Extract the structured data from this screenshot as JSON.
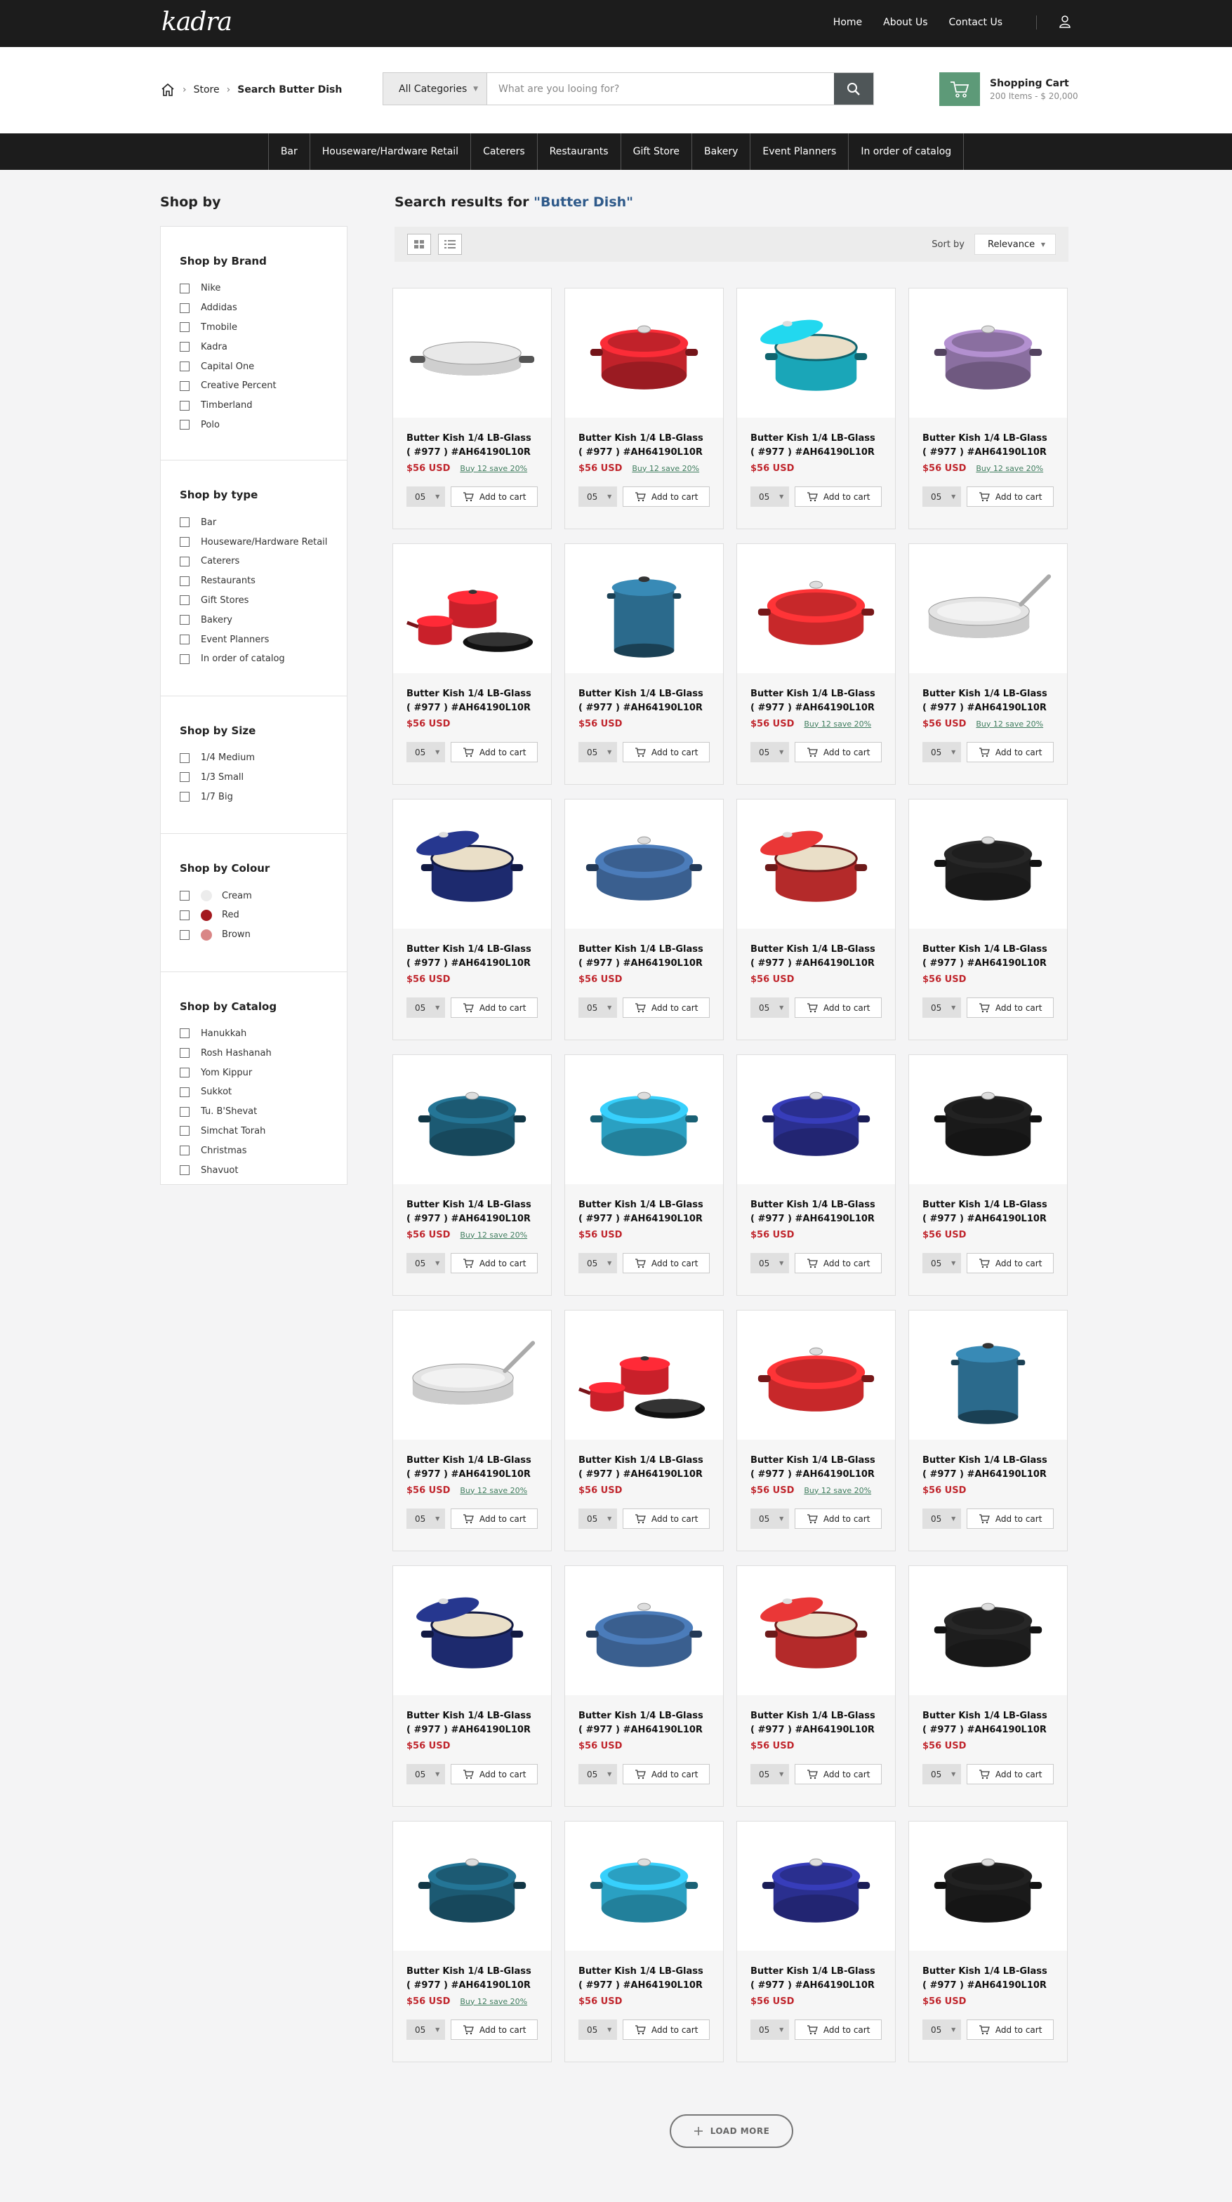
{
  "brand": {
    "logo": "kadra"
  },
  "topnav": [
    "Home",
    "About Us",
    "Contact Us"
  ],
  "breadcrumb": {
    "store": "Store",
    "current": "Search Butter Dish"
  },
  "search": {
    "category": "All Categories",
    "placeholder": "What are you looing for?"
  },
  "cart": {
    "title": "Shopping Cart",
    "summary": "200 Items - $ 20,000",
    "accent": "#5d9a78"
  },
  "categories": [
    "Bar",
    "Houseware/Hardware Retail",
    "Caterers",
    "Restaurants",
    "Gift Store",
    "Bakery",
    "Event Planners",
    "In order of catalog"
  ],
  "sidebar": {
    "title": "Shop by",
    "sections": [
      {
        "title": "Shop by Brand",
        "items": [
          "Nike",
          "Addidas",
          "Tmobile",
          "Kadra",
          "Capital One",
          "Creative Percent",
          "Timberland",
          "Polo"
        ]
      },
      {
        "title": "Shop by type",
        "items": [
          "Bar",
          "Houseware/Hardware Retail",
          "Caterers",
          "Restaurants",
          "Gift Stores",
          "Bakery",
          "Event Planners",
          "In order of catalog"
        ]
      },
      {
        "title": "Shop by Size",
        "items": [
          "1/4 Medium",
          "1/3 Small",
          "1/7 Big"
        ]
      },
      {
        "title": "Shop by Colour",
        "items": [
          "Cream",
          "Red",
          "Brown"
        ],
        "colors": [
          "#ececec",
          "#a3181e",
          "#d98686"
        ]
      },
      {
        "title": "Shop by Catalog",
        "items": [
          "Hanukkah",
          "Rosh Hashanah",
          "Yom Kippur",
          "Sukkot",
          "Tu. B'Shevat",
          "Simchat Torah",
          "Christmas",
          "Shavuot"
        ]
      }
    ]
  },
  "results": {
    "prefix": "Search results for ",
    "query": "\"Butter Dish\""
  },
  "sort": {
    "label": "Sort by",
    "value": "Relevance"
  },
  "product_template": {
    "name_line1": "Butter Kish 1/4 LB-Glass",
    "name_line2": "( #977 ) #AH64190L10R",
    "price": "$56 USD",
    "promo": "Buy 12 save 20%",
    "qty": "05",
    "add_label": "Add to cart"
  },
  "products": [
    {
      "kind": "pan",
      "color": "#b8b8b8",
      "promo": true
    },
    {
      "kind": "pot",
      "color": "#c1222a",
      "promo": true
    },
    {
      "kind": "potopen",
      "color": "#1aa6b8",
      "promo": false
    },
    {
      "kind": "pot",
      "color": "#8a6fa0",
      "promo": true
    },
    {
      "kind": "set",
      "color": "#c9202a",
      "promo": false
    },
    {
      "kind": "stock",
      "color": "#2b6a8c",
      "promo": false
    },
    {
      "kind": "oval",
      "color": "#c7282a",
      "promo": true
    },
    {
      "kind": "skillet",
      "color": "#c4c4c4",
      "promo": true
    },
    {
      "kind": "potopen",
      "color": "#1d2a6e",
      "promo": false
    },
    {
      "kind": "oval",
      "color": "#3a5f8f",
      "promo": false
    },
    {
      "kind": "potopen",
      "color": "#b42a2a",
      "promo": false
    },
    {
      "kind": "pot",
      "color": "#1e1e1e",
      "promo": false
    },
    {
      "kind": "pot",
      "color": "#1c5a73",
      "promo": true
    },
    {
      "kind": "pot",
      "color": "#2aa0c2",
      "promo": false
    },
    {
      "kind": "pot",
      "color": "#2a2f8f",
      "promo": false
    },
    {
      "kind": "pot",
      "color": "#1a1a1a",
      "promo": false
    },
    {
      "kind": "skillet",
      "color": "#c4c4c4",
      "promo": true
    },
    {
      "kind": "set",
      "color": "#c9202a",
      "promo": false
    },
    {
      "kind": "oval",
      "color": "#c7282a",
      "promo": true
    },
    {
      "kind": "stock",
      "color": "#2b6a8c",
      "promo": false
    },
    {
      "kind": "potopen",
      "color": "#1d2a6e",
      "promo": false
    },
    {
      "kind": "oval",
      "color": "#3a5f8f",
      "promo": false
    },
    {
      "kind": "potopen",
      "color": "#b42a2a",
      "promo": false
    },
    {
      "kind": "pot",
      "color": "#1e1e1e",
      "promo": false
    },
    {
      "kind": "pot",
      "color": "#1c5a73",
      "promo": true
    },
    {
      "kind": "pot",
      "color": "#2aa0c2",
      "promo": false
    },
    {
      "kind": "pot",
      "color": "#2a2f8f",
      "promo": false
    },
    {
      "kind": "pot",
      "color": "#1a1a1a",
      "promo": false
    }
  ],
  "load_more": "LOAD MORE"
}
